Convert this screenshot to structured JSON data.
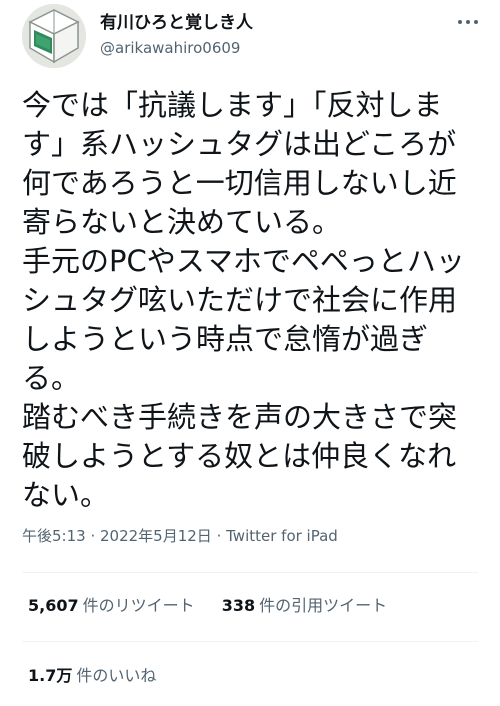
{
  "user": {
    "display_name": "有川ひろと覚しき人",
    "handle": "@arikawahiro0609",
    "more_icon": "more-horizontal-icon"
  },
  "tweet": {
    "lines": [
      "今では「抗議します」「反対しま",
      "す」系ハッシュタグは出どころが",
      "何であろうと一切信用しないし近",
      "寄らないと決めている。",
      "手元のPCやスマホでペペっとハッ",
      "シュタグ呟いただけで社会に作用",
      "しようという時点で怠惰が過ぎ",
      "る。",
      "踏むべき手続きを声の大きさで突",
      "破しようとする奴とは仲良くなれ",
      "ない。"
    ]
  },
  "meta": {
    "time": "午後5:13",
    "sep1": " · ",
    "date": "2022年5月12日",
    "sep2": " · ",
    "source": "Twitter for iPad"
  },
  "stats": {
    "retweets_count": "5,607",
    "retweets_label": "件のリツイート",
    "quotes_count": "338",
    "quotes_label": "件の引用ツイート",
    "likes_count": "1.7万",
    "likes_label": "件のいいね"
  },
  "colors": {
    "text": "#0f1419",
    "secondary": "#536471",
    "divider": "#eff3f4"
  }
}
